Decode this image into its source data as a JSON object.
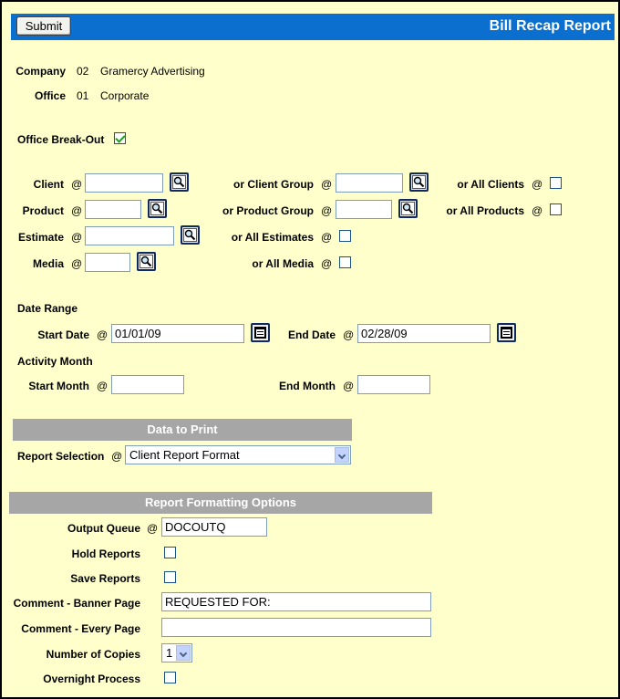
{
  "header": {
    "submit_label": "Submit",
    "title": "Bill Recap Report"
  },
  "info": {
    "company_label": "Company",
    "company_code": "02",
    "company_name": "Gramercy Advertising",
    "office_label": "Office",
    "office_code": "01",
    "office_name": "Corporate"
  },
  "breakout": {
    "label": "Office Break-Out",
    "checked": true
  },
  "filters": {
    "at": "@",
    "client_label": "Client",
    "client_value": "",
    "client_group_label": "or Client Group",
    "client_group_value": "",
    "all_clients_label": "or All Clients",
    "product_label": "Product",
    "product_value": "",
    "product_group_label": "or Product Group",
    "product_group_value": "",
    "all_products_label": "or All Products",
    "estimate_label": "Estimate",
    "estimate_value": "",
    "all_estimates_label": "or All Estimates",
    "media_label": "Media",
    "media_value": "",
    "all_media_label": "or All Media"
  },
  "dates": {
    "date_range_label": "Date Range",
    "start_date_label": "Start Date",
    "start_date_value": "01/01/09",
    "end_date_label": "End Date",
    "end_date_value": "02/28/09",
    "activity_month_label": "Activity Month",
    "start_month_label": "Start Month",
    "start_month_value": "",
    "end_month_label": "End Month",
    "end_month_value": ""
  },
  "data_to_print": {
    "header": "Data to Print",
    "report_selection_label": "Report Selection",
    "report_selection_value": "Client Report Format"
  },
  "formatting": {
    "header": "Report Formatting Options",
    "output_queue_label": "Output Queue",
    "output_queue_value": "DOCOUTQ",
    "hold_reports_label": "Hold Reports",
    "save_reports_label": "Save Reports",
    "comment_banner_label": "Comment - Banner Page",
    "comment_banner_value": "REQUESTED FOR:",
    "comment_every_label": "Comment - Every Page",
    "comment_every_value": "",
    "copies_label": "Number of Copies",
    "copies_value": "1",
    "overnight_label": "Overnight Process"
  }
}
